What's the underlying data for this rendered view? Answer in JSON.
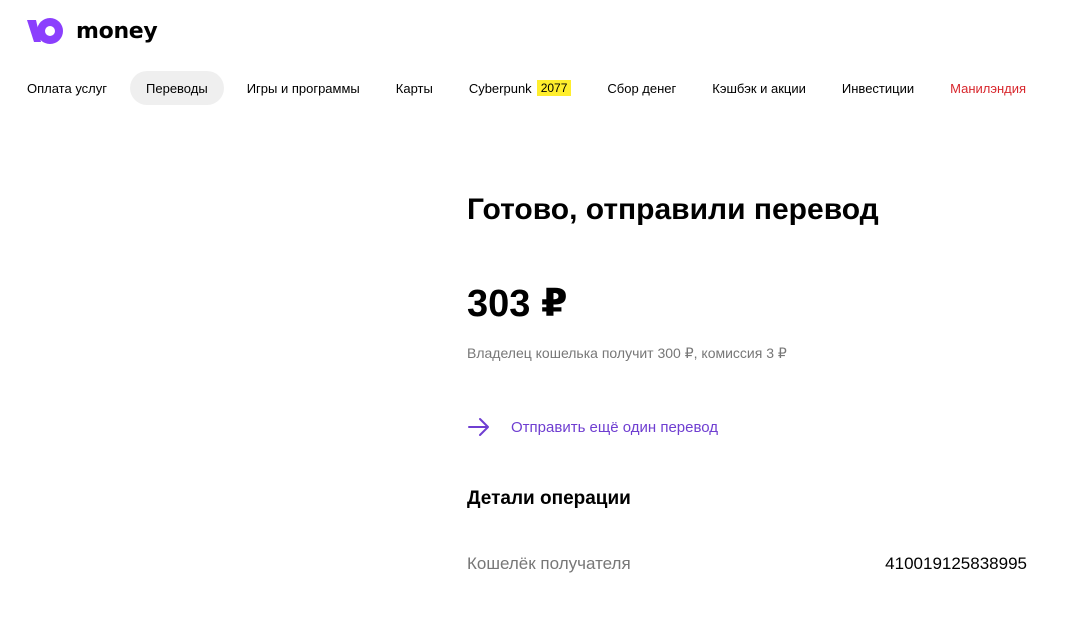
{
  "header": {
    "logo_text": "money",
    "brand_color": "#8b3ffd"
  },
  "nav": {
    "items": [
      {
        "label": "Оплата услуг"
      },
      {
        "label": "Переводы",
        "active": true
      },
      {
        "label": "Игры и программы"
      },
      {
        "label": "Карты"
      },
      {
        "label": "Cyberpunk",
        "badge": "2077"
      },
      {
        "label": "Сбор денег"
      },
      {
        "label": "Кэшбэк и акции"
      },
      {
        "label": "Инвестиции"
      },
      {
        "label": "Манилэндия",
        "color": "#d8262c"
      }
    ]
  },
  "main": {
    "title": "Готово, отправили перевод",
    "amount": "303 ₽",
    "subtitle": "Владелец кошелька получит 300 ₽, комиссия 3 ₽",
    "again_link": {
      "icon": "arrow-right-icon",
      "label": "Отправить ещё один перевод",
      "color": "#6f3ed1"
    },
    "details": {
      "title": "Детали операции",
      "rows": [
        {
          "label": "Кошелёк получателя",
          "value": "410019125838995"
        }
      ]
    }
  }
}
